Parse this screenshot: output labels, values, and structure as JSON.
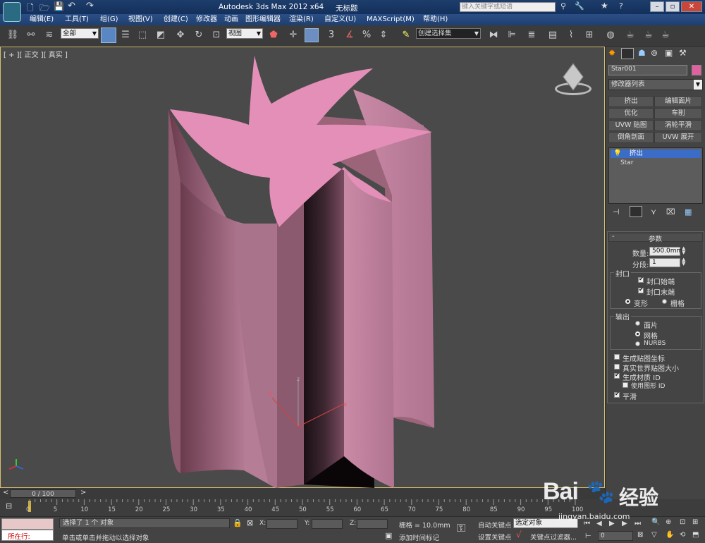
{
  "title_bar": {
    "app_title": "Autodesk 3ds Max  2012 x64",
    "doc_title": "无标题",
    "search_placeholder": "键入关键字或短语"
  },
  "menu": [
    "编辑(E)",
    "工具(T)",
    "组(G)",
    "视图(V)",
    "创建(C)",
    "修改器",
    "动画",
    "图形编辑器",
    "渲染(R)",
    "自定义(U)",
    "MAXScript(M)",
    "帮助(H)"
  ],
  "toolbar": {
    "filter_value": "全部",
    "view_value": "视图",
    "selection_set_value": "创建选择集",
    "snap_number": "3"
  },
  "viewport": {
    "label": "[ + ][ 正交 ][ 真实 ]",
    "axis_x": "x",
    "axis_y": "y",
    "axis_z": "z"
  },
  "panel": {
    "object_name": "Star001",
    "object_color": "#e060a0",
    "modifier_list_label": "修改器列表",
    "buttons": [
      "挤出",
      "编辑面片",
      "优化",
      "车削",
      "UVW 贴图",
      "涡轮平滑",
      "倒角剖面",
      "UVW 展开"
    ],
    "stack": [
      "挤出",
      "Star"
    ],
    "params_title": "参数",
    "amount_label": "数量:",
    "amount_value": "500.0mm",
    "segments_label": "分段:",
    "segments_value": "1",
    "capping_title": "封口",
    "cap_start": "封口始端",
    "cap_end": "封口末端",
    "morph": "变形",
    "grid": "栅格",
    "output_title": "输出",
    "patch": "面片",
    "mesh": "网格",
    "nurbs": "NURBS",
    "gen_map_coords": "生成贴图坐标",
    "real_world": "真实世界贴图大小",
    "gen_mat_ids": "生成材质 ID",
    "use_shape_ids": "使用图形 ID",
    "smooth": "平滑"
  },
  "timeline": {
    "frame_display": "0 / 100",
    "ticks": [
      "0",
      "5",
      "10",
      "15",
      "20",
      "25",
      "30",
      "35",
      "40",
      "45",
      "50",
      "55",
      "60",
      "65",
      "70",
      "75",
      "80",
      "85",
      "90",
      "95",
      "100"
    ]
  },
  "status": {
    "running_label": "所在行:",
    "selection_text": "选择了 1 个 对象",
    "hint_text": "单击或单击并拖动以选择对象",
    "x_label": "X:",
    "y_label": "Y:",
    "z_label": "Z:",
    "grid_text": "栅格 = 10.0mm",
    "add_time_tag": "添加时间标记",
    "auto_key": "自动关键点",
    "selected_object": "选定对象",
    "set_key": "设置关键点",
    "key_filters": "关键点过滤器...",
    "frame_value": "0"
  },
  "watermark": {
    "text": "经验",
    "url": "jingyan.baidu.com"
  }
}
